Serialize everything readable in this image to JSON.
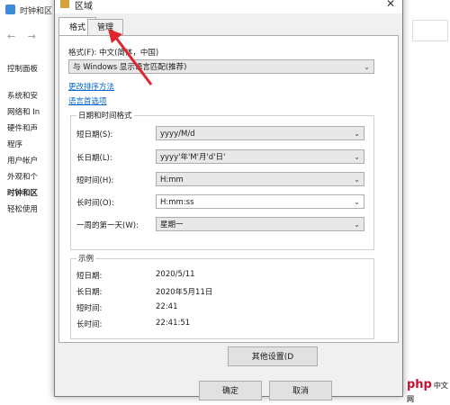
{
  "background": {
    "title": "时钟和区",
    "nav_back": "←",
    "nav_fwd": "→",
    "menu": [
      "控制面板",
      "系统和安",
      "网络和 In",
      "硬件和声",
      "程序",
      "用户帐户",
      "外观和个",
      "时钟和区",
      "轻松使用"
    ],
    "selected_index": 7
  },
  "dialog": {
    "title": "区域",
    "tabs": [
      "格式",
      "管理"
    ],
    "format_label": "格式(F): 中文(简体，中国)",
    "format_value": "与 Windows 显示语言匹配(推荐)",
    "link_sort": "更改排序方法",
    "link_lang": "语言首选项",
    "datetime_group": "日期和时间格式",
    "rows": [
      {
        "label": "短日期(S):",
        "value": "yyyy/M/d"
      },
      {
        "label": "长日期(L):",
        "value": "yyyy'年'M'月'd'日'"
      },
      {
        "label": "短时间(H):",
        "value": "H:mm"
      },
      {
        "label": "长时间(O):",
        "value": "H:mm:ss"
      },
      {
        "label": "一周的第一天(W):",
        "value": "星期一"
      }
    ],
    "example_group": "示例",
    "examples": [
      {
        "label": "短日期:",
        "value": "2020/5/11"
      },
      {
        "label": "长日期:",
        "value": "2020年5月11日"
      },
      {
        "label": "短时间:",
        "value": "22:41"
      },
      {
        "label": "长时间:",
        "value": "22:41:51"
      }
    ],
    "other_settings": "其他设置(D",
    "ok": "确定",
    "cancel": "取消"
  },
  "watermark": "php"
}
